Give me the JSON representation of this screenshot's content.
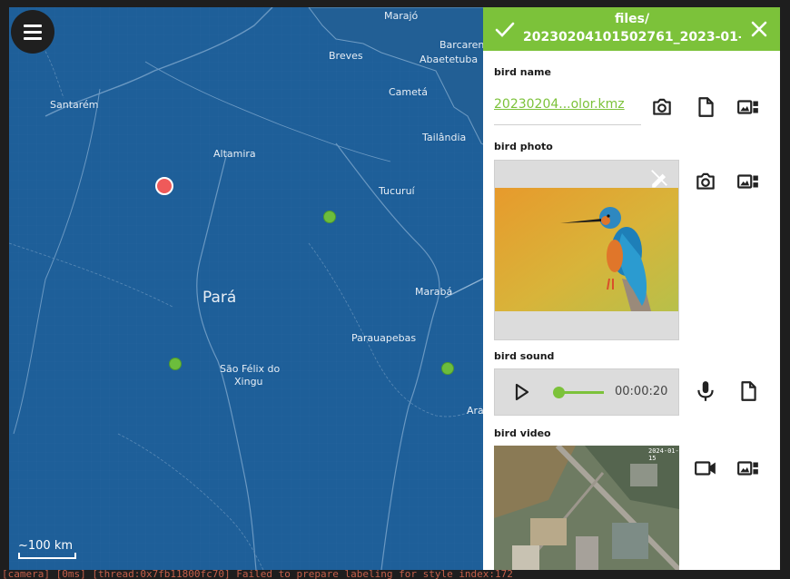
{
  "map": {
    "places": [
      {
        "name": "Marajó",
        "big": false
      },
      {
        "name": "Barcarena",
        "big": false
      },
      {
        "name": "Abaetetuba",
        "big": false
      },
      {
        "name": "Breves",
        "big": false
      },
      {
        "name": "Cametá",
        "big": false
      },
      {
        "name": "Santarém",
        "big": false
      },
      {
        "name": "Tailândia",
        "big": false
      },
      {
        "name": "Altamira",
        "big": false
      },
      {
        "name": "Tucuruí",
        "big": false
      },
      {
        "name": "Pará",
        "big": true
      },
      {
        "name": "Marabá",
        "big": false
      },
      {
        "name": "Parauapebas",
        "big": false
      },
      {
        "name": "São Félix do",
        "big": false
      },
      {
        "name": "Xingu",
        "big": false
      },
      {
        "name": "Ara",
        "big": false
      }
    ],
    "markers": [
      {
        "color": "red"
      },
      {
        "color": "green"
      },
      {
        "color": "green"
      },
      {
        "color": "green"
      }
    ],
    "scale_label": "~100 km",
    "water_color": "#1e5f99",
    "marker_green": "#6cbd3c",
    "marker_red": "#ef5a5a"
  },
  "panel": {
    "title_line1": "files/",
    "title_line2": "20230204101502761_2023-01-...",
    "accent": "#7cc23a",
    "fields": {
      "bird_name": {
        "label": "bird name",
        "file": "20230204...olor.kmz"
      },
      "bird_photo": {
        "label": "bird photo"
      },
      "bird_sound": {
        "label": "bird sound",
        "time": "00:00:20"
      },
      "bird_video": {
        "label": "bird video",
        "stamp": "2024-01-15"
      }
    }
  },
  "terminal": {
    "bottom_text": "[camera] [0ms] [thread:0x7fb11800fc70] Failed to prepare labeling for style index:172"
  }
}
